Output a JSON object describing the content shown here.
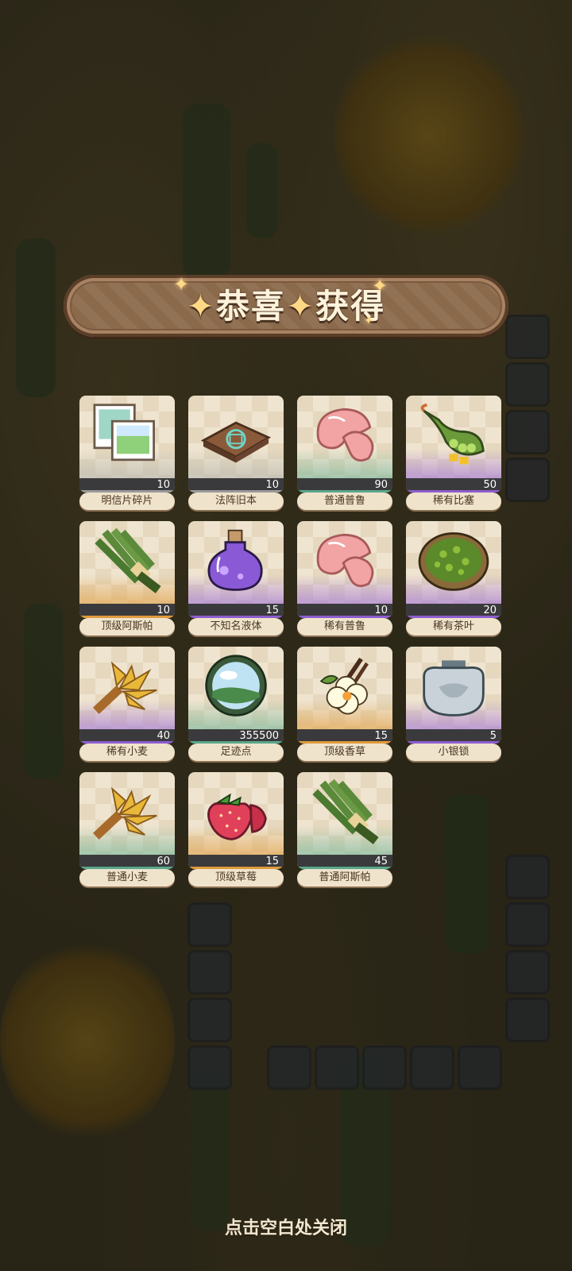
{
  "banner": {
    "title_part1": "恭喜",
    "title_part2": "获得"
  },
  "items": [
    {
      "name": "明信片碎片",
      "count": "10",
      "rarity": "gray",
      "icon": "postcard-icon"
    },
    {
      "name": "法阵旧本",
      "count": "10",
      "rarity": "gray",
      "icon": "old-book-icon"
    },
    {
      "name": "普通普鲁",
      "count": "90",
      "rarity": "green",
      "icon": "pink-mushroom-icon"
    },
    {
      "name": "稀有比塞",
      "count": "50",
      "rarity": "purple",
      "icon": "pea-pod-icon"
    },
    {
      "name": "顶级阿斯帕",
      "count": "10",
      "rarity": "orange",
      "icon": "asparagus-icon"
    },
    {
      "name": "不知名液体",
      "count": "15",
      "rarity": "purple",
      "icon": "potion-icon"
    },
    {
      "name": "稀有普鲁",
      "count": "10",
      "rarity": "purple",
      "icon": "pink-mushroom-icon"
    },
    {
      "name": "稀有茶叶",
      "count": "20",
      "rarity": "purple",
      "icon": "tea-leaves-icon"
    },
    {
      "name": "稀有小麦",
      "count": "40",
      "rarity": "purple",
      "icon": "wheat-icon"
    },
    {
      "name": "足迹点",
      "count": "355500",
      "rarity": "green",
      "icon": "footprint-orb-icon"
    },
    {
      "name": "顶级香草",
      "count": "15",
      "rarity": "orange",
      "icon": "vanilla-flower-icon"
    },
    {
      "name": "小银锁",
      "count": "5",
      "rarity": "purple",
      "icon": "silver-lock-icon"
    },
    {
      "name": "普通小麦",
      "count": "60",
      "rarity": "green",
      "icon": "wheat-icon"
    },
    {
      "name": "顶级草莓",
      "count": "15",
      "rarity": "orange",
      "icon": "strawberry-icon"
    },
    {
      "name": "普通阿斯帕",
      "count": "45",
      "rarity": "green",
      "icon": "asparagus-icon"
    }
  ],
  "close_hint": "点击空白处关闭",
  "colors": {
    "banner": "#8b6a4c",
    "gray": "#9a9a9a",
    "green": "#5aa78a",
    "purple": "#8e5ccf",
    "orange": "#e09a3c"
  }
}
